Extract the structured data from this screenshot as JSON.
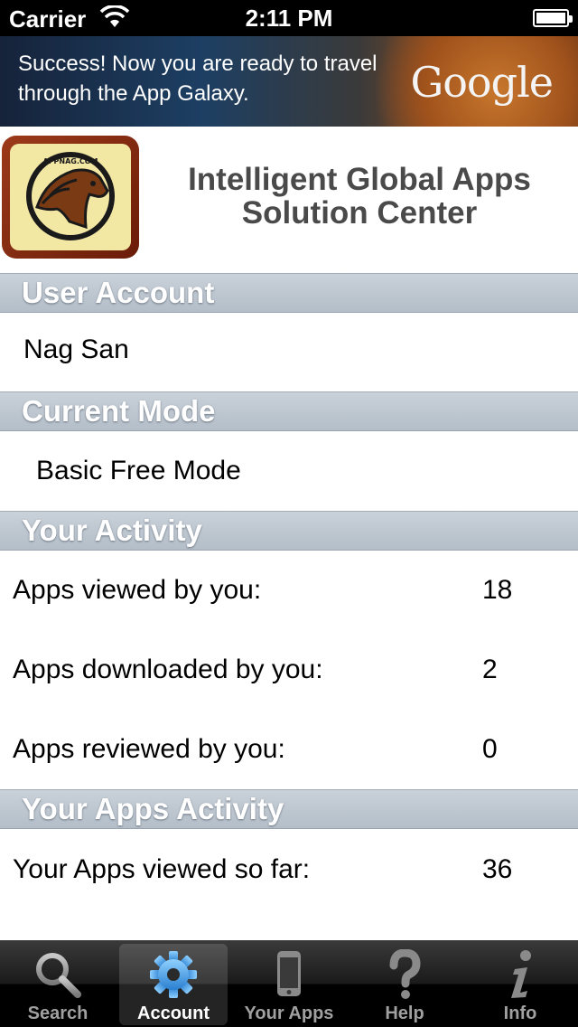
{
  "status_bar": {
    "carrier": "Carrier",
    "time": "2:11 PM"
  },
  "banner": {
    "message": "Success! Now you are ready to travel through the App Galaxy.",
    "brand": "Google"
  },
  "header": {
    "logo_text": "APPNAG.COM",
    "title_line1": "Intelligent Global Apps",
    "title_line2": "Solution Center"
  },
  "sections": {
    "user_account": {
      "heading": "User Account",
      "value": "Nag San"
    },
    "current_mode": {
      "heading": "Current Mode",
      "value": "Basic Free Mode"
    },
    "your_activity": {
      "heading": "Your Activity",
      "rows": [
        {
          "label": "Apps viewed by you:",
          "value": "18"
        },
        {
          "label": "Apps downloaded by you:",
          "value": "2"
        },
        {
          "label": "Apps reviewed by you:",
          "value": "0"
        }
      ]
    },
    "your_apps_activity": {
      "heading": "Your Apps Activity",
      "rows": [
        {
          "label": "Your Apps viewed so far:",
          "value": "36"
        }
      ]
    }
  },
  "tab_bar": {
    "tabs": [
      {
        "label": "Search",
        "icon": "search-icon",
        "active": false
      },
      {
        "label": "Account",
        "icon": "gear-icon",
        "active": true
      },
      {
        "label": "Your Apps",
        "icon": "phone-icon",
        "active": false
      },
      {
        "label": "Help",
        "icon": "question-mark-icon",
        "active": false
      },
      {
        "label": "Info",
        "icon": "info-icon",
        "active": false
      }
    ]
  },
  "colors": {
    "accent_tab_icon": "#3b8fd8",
    "section_header": "#b9c3cd"
  }
}
